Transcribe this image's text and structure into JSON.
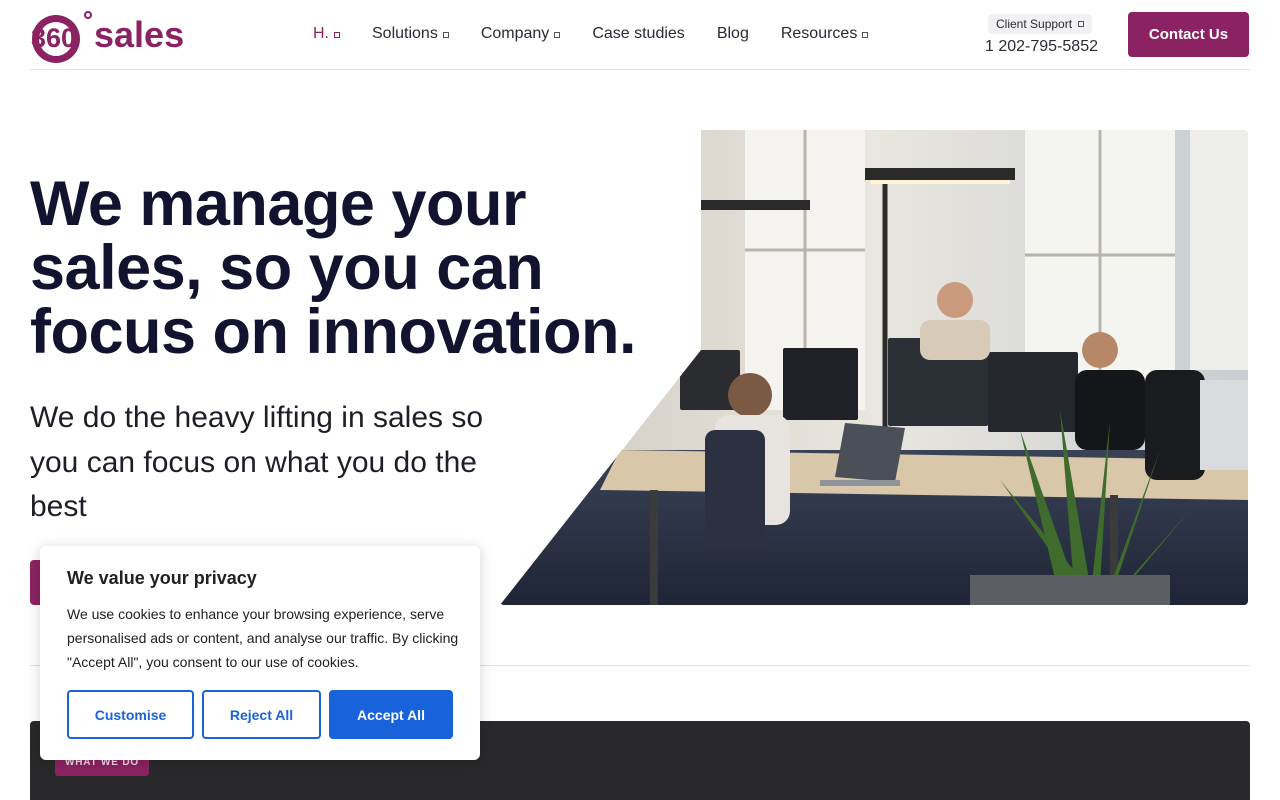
{
  "brand": {
    "logo_digits": "360",
    "logo_word": "sales",
    "primary_color": "#8b2362",
    "dark_text_color": "#12132f",
    "accent_blue": "#1863dc"
  },
  "nav": {
    "items": [
      {
        "label": "H.",
        "has_dropdown": true,
        "active": true
      },
      {
        "label": "Solutions",
        "has_dropdown": true
      },
      {
        "label": "Company",
        "has_dropdown": true
      },
      {
        "label": "Case studies",
        "has_dropdown": false
      },
      {
        "label": "Blog",
        "has_dropdown": false
      },
      {
        "label": "Resources",
        "has_dropdown": true
      }
    ]
  },
  "support": {
    "label": "Client Support",
    "phone": "1 202-795-5852"
  },
  "header": {
    "contact_label": "Contact Us"
  },
  "hero": {
    "title": "We manage your sales, so you can focus on innovation.",
    "subtitle": "We do the heavy lifting in sales so you can focus on what you do the best"
  },
  "section": {
    "badge": "WHAT WE DO"
  },
  "cookie": {
    "title": "We value your privacy",
    "text": "We use cookies to enhance your browsing experience, serve personalised ads or content, and analyse our traffic. By clicking \"Accept All\", you consent to our use of cookies.",
    "customise_label": "Customise",
    "reject_label": "Reject All",
    "accept_label": "Accept All"
  }
}
